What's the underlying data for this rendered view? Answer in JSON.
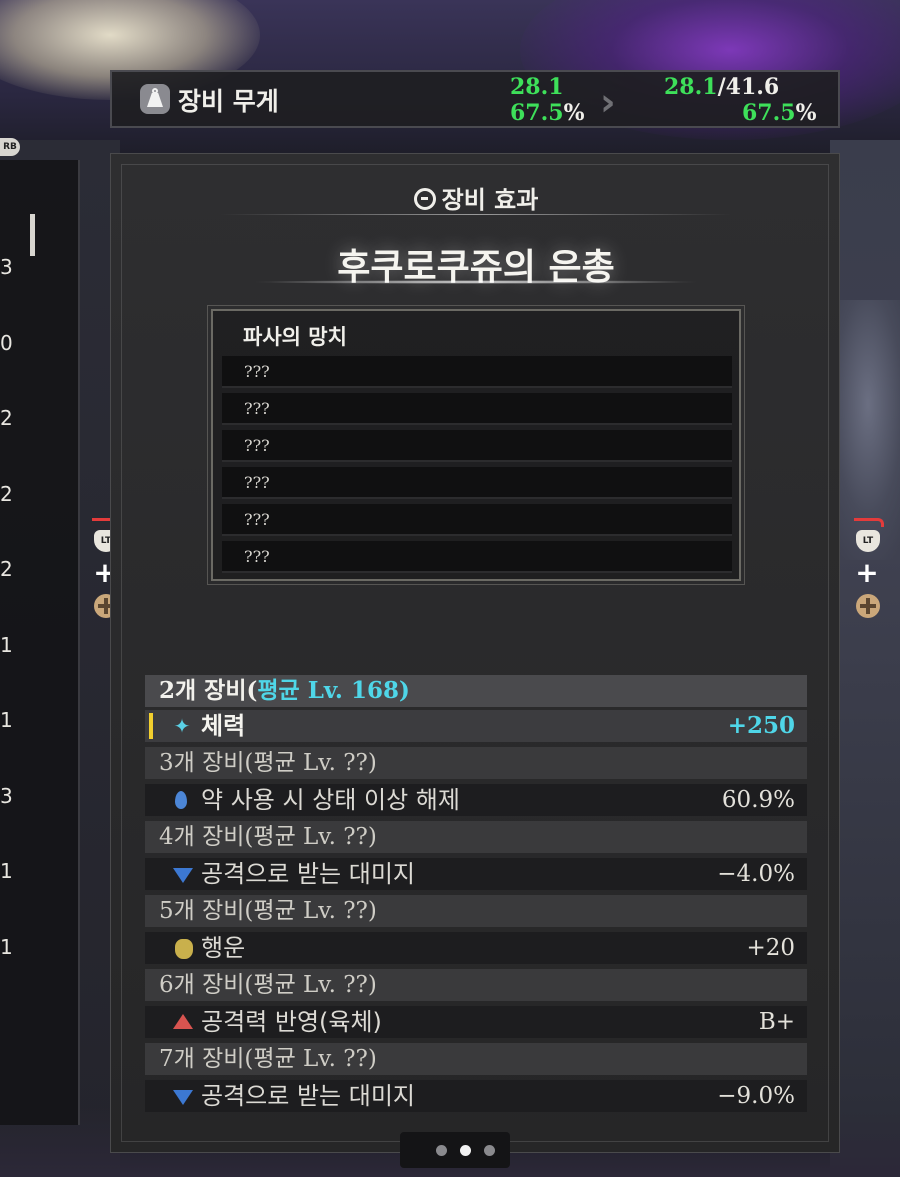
{
  "left_list": {
    "badge": "RB",
    "cells": [
      "3",
      "0",
      "2",
      "2",
      "2",
      "1",
      "1",
      "3",
      "1",
      "1"
    ]
  },
  "weight": {
    "title": "장비 무게",
    "current_value": "28.1",
    "current_percent": "67.5",
    "new_value": "28.1",
    "max_value": "41.6",
    "new_percent": "67.5",
    "percent_sign": "%",
    "slash": "/",
    "colors": {
      "good": "#3ee05a",
      "neutral": "#f0efea"
    }
  },
  "panel": {
    "header": "장비 효과",
    "set_name": "후쿠로쿠쥬의 은총",
    "skill": {
      "title": "파사의 망치",
      "rows": [
        "???",
        "???",
        "???",
        "???",
        "???",
        "???"
      ]
    },
    "tiers": [
      {
        "head": "2개 장비(",
        "level": "평균 Lv. 168",
        "close": ")",
        "effect": "체력",
        "value": "+250",
        "icon": "sparkle-icon",
        "active": true
      },
      {
        "head": "3개 장비(",
        "level": "평균 Lv. ??",
        "close": ")",
        "effect": "약 사용 시 상태 이상 해제",
        "value": "60.9%",
        "icon": "drop-icon",
        "active": false
      },
      {
        "head": "4개 장비(",
        "level": "평균 Lv. ??",
        "close": ")",
        "effect": "공격으로 받는 대미지",
        "value": "−4.0%",
        "icon": "down-arrow-icon",
        "active": false
      },
      {
        "head": "5개 장비(",
        "level": "평균 Lv. ??",
        "close": ")",
        "effect": "행운",
        "value": "+20",
        "icon": "luck-bag-icon",
        "active": false
      },
      {
        "head": "6개 장비(",
        "level": "평균 Lv. ??",
        "close": ")",
        "effect": "공격력 반영(육체)",
        "value": "B+",
        "icon": "up-arrow-icon",
        "active": false
      },
      {
        "head": "7개 장비(",
        "level": "평균 Lv. ??",
        "close": ")",
        "effect": "공격으로 받는 대미지",
        "value": "−9.0%",
        "icon": "down-arrow-icon",
        "active": false
      }
    ]
  },
  "controls": {
    "trigger": "LT",
    "plus": "+"
  },
  "pager": {
    "pages": 3,
    "current": 2
  },
  "colors": {
    "accent": "#4fd6e8",
    "marker": "#f2cf2e"
  }
}
